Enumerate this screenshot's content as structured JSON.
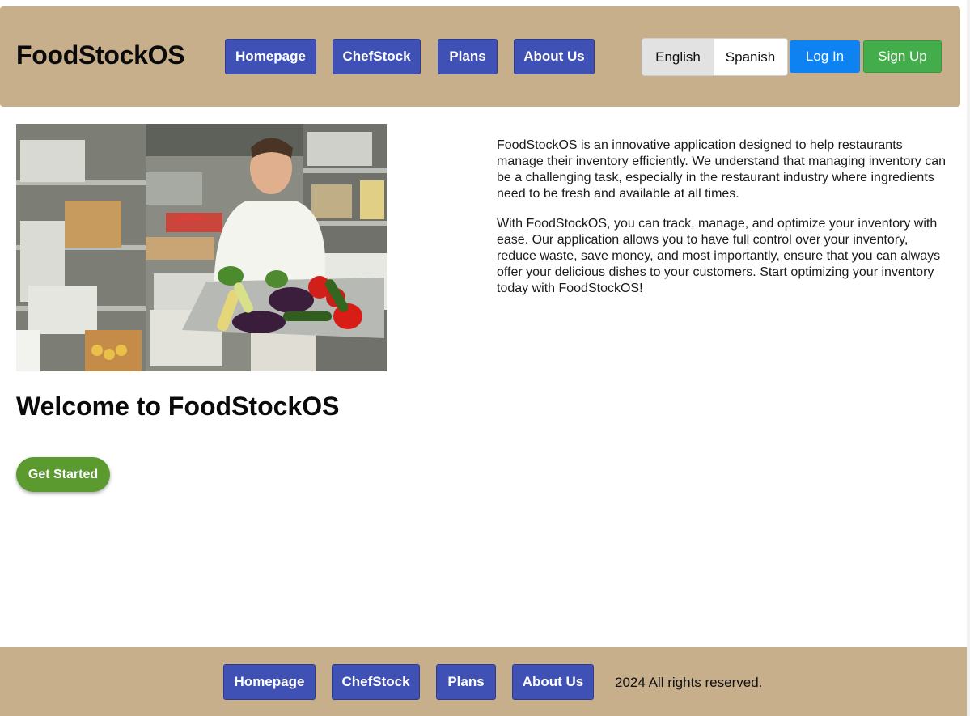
{
  "header": {
    "brand": "FoodStockOS",
    "nav": [
      {
        "label": "Homepage"
      },
      {
        "label": "ChefStock"
      },
      {
        "label": "Plans"
      },
      {
        "label": "About Us"
      }
    ],
    "languages": {
      "english": "English",
      "spanish": "Spanish",
      "selected": "English"
    },
    "login_label": "Log In",
    "signup_label": "Sign Up"
  },
  "main": {
    "hero_image": "photo of a chef holding a tray of vegetables in a walk-in cooler",
    "title": "Welcome to FoodStockOS",
    "cta_label": "Get Started",
    "paragraphs": [
      "FoodStockOS is an innovative application designed to help restaurants manage their inventory efficiently. We understand that managing inventory can be a challenging task, especially in the restaurant industry where ingredients need to be fresh and available at all times.",
      "With FoodStockOS, you can track, manage, and optimize your inventory with ease. Our application allows you to have full control over your inventory, reduce waste, save money, and most importantly, ensure that you can always offer your delicious dishes to your customers. Start optimizing your inventory today with FoodStockOS!"
    ]
  },
  "footer": {
    "nav": [
      {
        "label": "Homepage"
      },
      {
        "label": "ChefStock"
      },
      {
        "label": "Plans"
      },
      {
        "label": "About Us"
      }
    ],
    "copyright": "2024 All rights reserved."
  },
  "colors": {
    "header_bg": "#c8af8c",
    "nav_button": "#3f51b5",
    "login_button": "#0d82f0",
    "signup_button": "#44ad4b",
    "cta_button": "#5a9a2f"
  }
}
